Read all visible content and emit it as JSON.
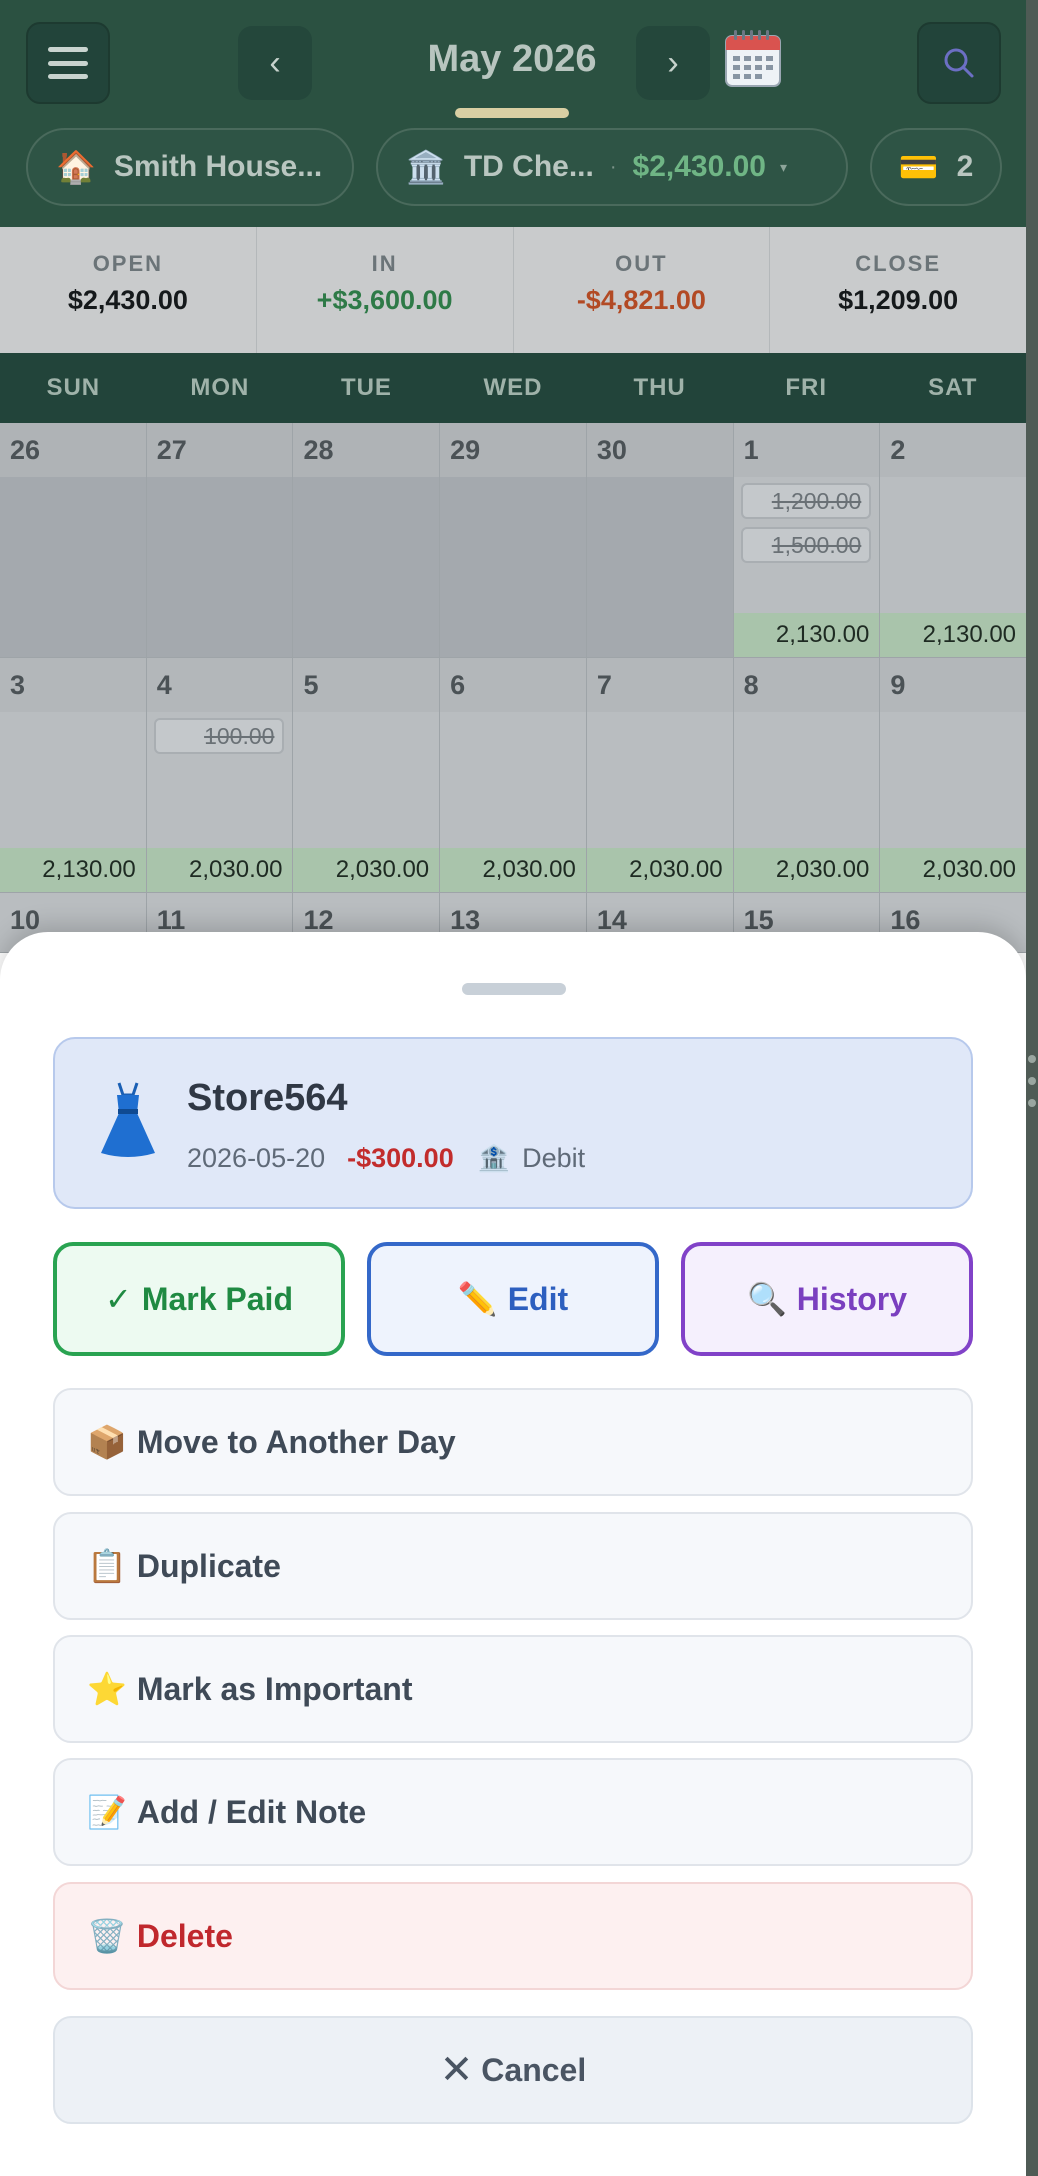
{
  "header": {
    "month_title": "May 2026",
    "prev_label": "‹",
    "next_label": "›",
    "household": "Smith House...",
    "account_name": "TD Che...",
    "account_separator": "·",
    "account_balance": "$2,430.00",
    "account_caret": "▾",
    "cards_count": "2"
  },
  "summary": [
    {
      "label": "OPEN",
      "value": "$2,430.00"
    },
    {
      "label": "IN",
      "value": "+$3,600.00"
    },
    {
      "label": "OUT",
      "value": "-$4,821.00"
    },
    {
      "label": "CLOSE",
      "value": "$1,209.00"
    }
  ],
  "weekdays": [
    "SUN",
    "MON",
    "TUE",
    "WED",
    "THU",
    "FRI",
    "SAT"
  ],
  "calendar": {
    "week1": {
      "days": [
        "26",
        "27",
        "28",
        "29",
        "30",
        "1",
        "2"
      ],
      "fri_txns": [
        "1,200.00",
        "1,500.00"
      ],
      "fri_balance": "2,130.00",
      "sat_balance": "2,130.00"
    },
    "week2": {
      "days": [
        "3",
        "4",
        "5",
        "6",
        "7",
        "8",
        "9"
      ],
      "mon_txn": "100.00",
      "balances": [
        "2,130.00",
        "2,030.00",
        "2,030.00",
        "2,030.00",
        "2,030.00",
        "2,030.00",
        "2,030.00"
      ]
    },
    "week3": {
      "days": [
        "10",
        "11",
        "12",
        "13",
        "14",
        "15",
        "16"
      ]
    }
  },
  "sheet": {
    "transaction": {
      "name": "Store564",
      "date": "2026-05-20",
      "amount": "-$300.00",
      "account_type": "Debit"
    },
    "actions": {
      "mark_paid": "Mark Paid",
      "edit": "Edit",
      "history": "History"
    },
    "options": {
      "move": "Move to Another Day",
      "duplicate": "Duplicate",
      "important": "Mark as Important",
      "note": "Add / Edit Note",
      "delete": "Delete",
      "cancel": "Cancel"
    }
  },
  "colors": {
    "header_bg": "#2b5141",
    "accent_green": "#29a351",
    "accent_blue": "#3468c9",
    "accent_purple": "#8142c8",
    "danger": "#c0282d",
    "in_green": "#2e7a47",
    "out_orange": "#b24a24"
  },
  "icons": {
    "menu": "hamburger-icon",
    "search": "search-icon",
    "calendar": "calendar-icon",
    "house": "house-icon",
    "bank": "bank-icon",
    "card": "credit-card-icon",
    "dress": "dress-icon",
    "check": "check-icon",
    "pencil": "pencil-icon",
    "magnifier": "magnifier-icon",
    "package": "package-icon",
    "clipboard": "clipboard-icon",
    "star": "star-icon",
    "memo": "memo-icon",
    "trash": "trash-icon",
    "close": "close-icon"
  }
}
